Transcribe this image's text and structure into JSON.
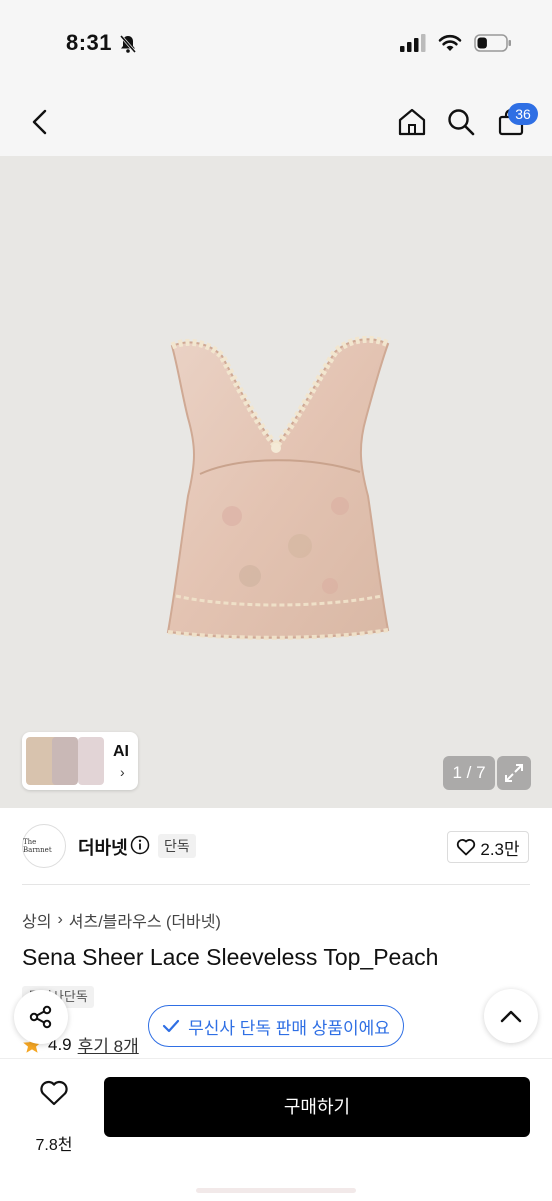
{
  "status": {
    "time": "8:31",
    "battery_level": 0.35
  },
  "nav": {
    "back_icon": "chevron-left-icon",
    "home_icon": "home-icon",
    "search_icon": "search-icon",
    "cart_icon": "shopping-bag-icon",
    "cart_count": "36"
  },
  "gallery": {
    "ai_label": "AI",
    "counter": "1 / 7"
  },
  "brand": {
    "logo_text": "The Barnnet",
    "name": "더바넷",
    "exclusive_tag": "단독",
    "likes": "2.3만"
  },
  "product": {
    "breadcrumb": [
      "상의",
      "셔츠/블라우스 (더바넷)"
    ],
    "title": "Sena Sheer Lace Sleeveless Top_Peach",
    "tag": "무신사단독",
    "rating": "4.9",
    "review_label": "후기 8개"
  },
  "banner": {
    "text": "무신사 단독 판매 상품이에요"
  },
  "bottom": {
    "wish_count": "7.8천",
    "buy_label": "구매하기"
  },
  "colors": {
    "accent": "#2f6fe4",
    "buy_button": "#000000",
    "star": "#f5a623"
  }
}
